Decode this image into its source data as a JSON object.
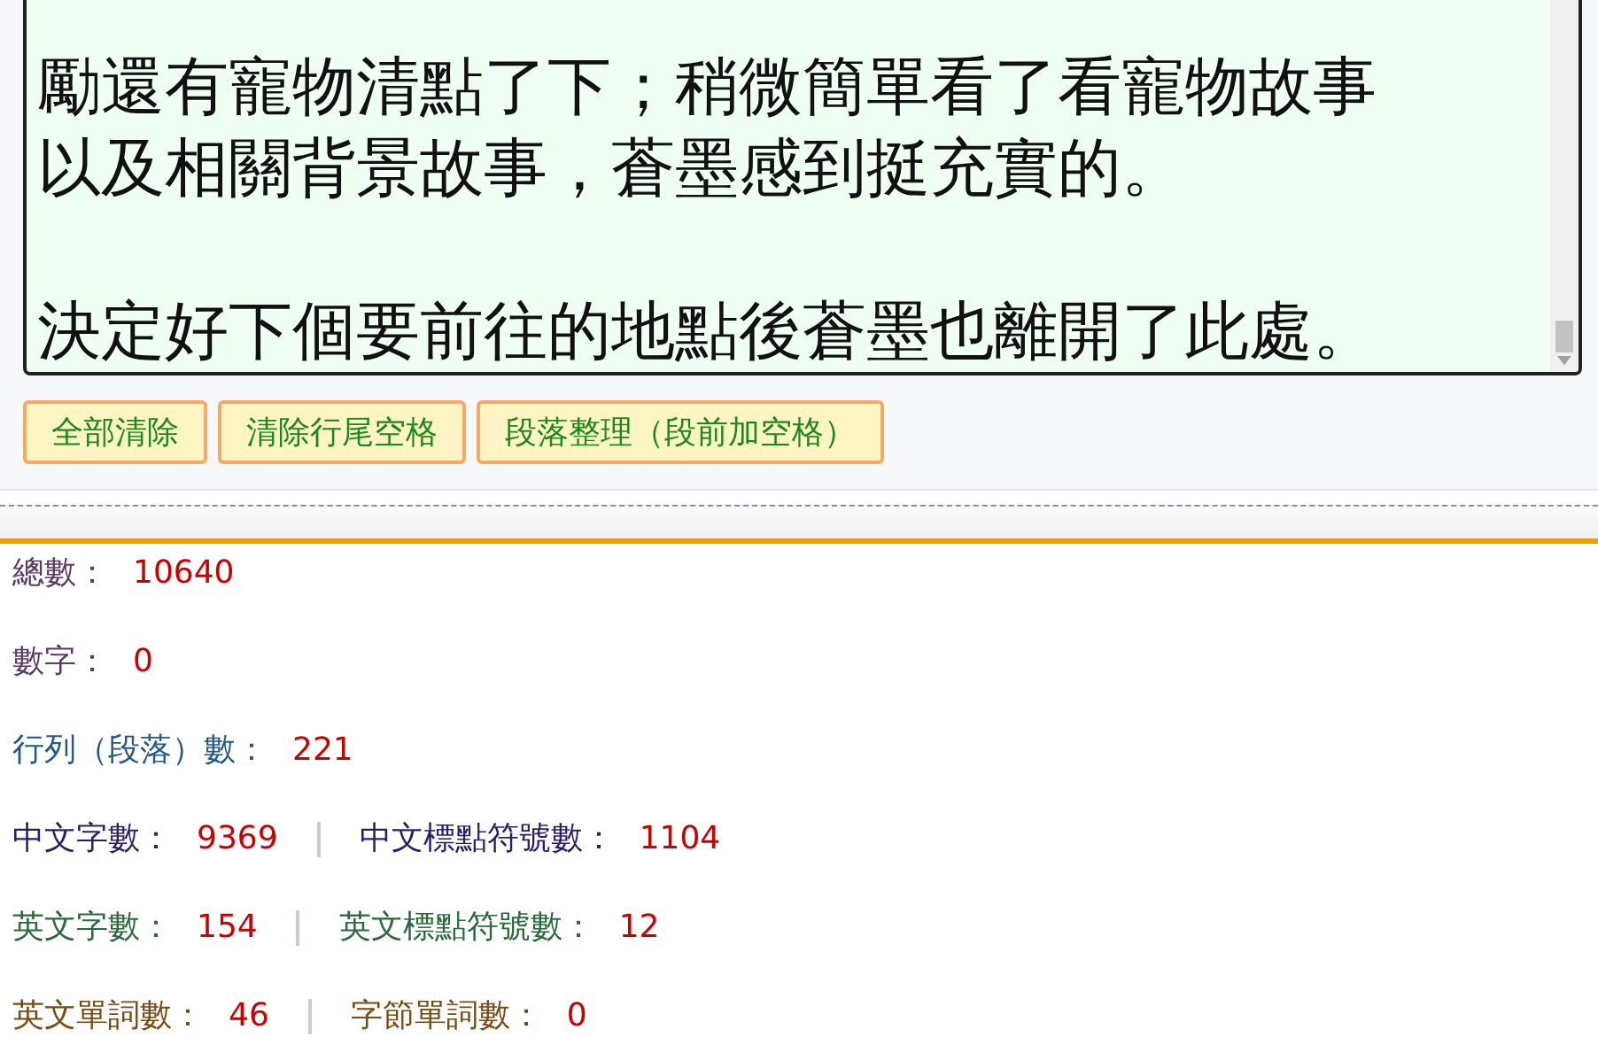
{
  "editor": {
    "paragraphs": [
      [
        "勵還有寵物清點了下；稍微簡單看了看寵物故事",
        "以及相關背景故事，蒼墨感到挺充實的。"
      ],
      [
        "決定好下個要前往的地點後蒼墨也離開了此處。"
      ]
    ]
  },
  "buttons": [
    "全部清除",
    "清除行尾空格",
    "段落整理（段前加空格）"
  ],
  "stats": [
    {
      "color": "#5a3a6a",
      "items": [
        {
          "label": "總數：",
          "value": "10640"
        }
      ]
    },
    {
      "color": "#5a3a6a",
      "items": [
        {
          "label": "數字：",
          "value": "0"
        }
      ]
    },
    {
      "color": "#23588a",
      "items": [
        {
          "label": "行列（段落）數：",
          "value": "221"
        }
      ]
    },
    {
      "color": "#2a1e6a",
      "items": [
        {
          "label": "中文字數：",
          "value": "9369"
        },
        {
          "label": "中文標點符號數：",
          "value": "1104"
        }
      ]
    },
    {
      "color": "#2a6a3a",
      "items": [
        {
          "label": "英文字數：",
          "value": "154"
        },
        {
          "label": "英文標點符號數：",
          "value": "12"
        }
      ]
    },
    {
      "color": "#7a4a12",
      "items": [
        {
          "label": "英文單詞數：",
          "value": "46"
        },
        {
          "label": "字節單詞數：",
          "value": "0"
        }
      ]
    }
  ]
}
